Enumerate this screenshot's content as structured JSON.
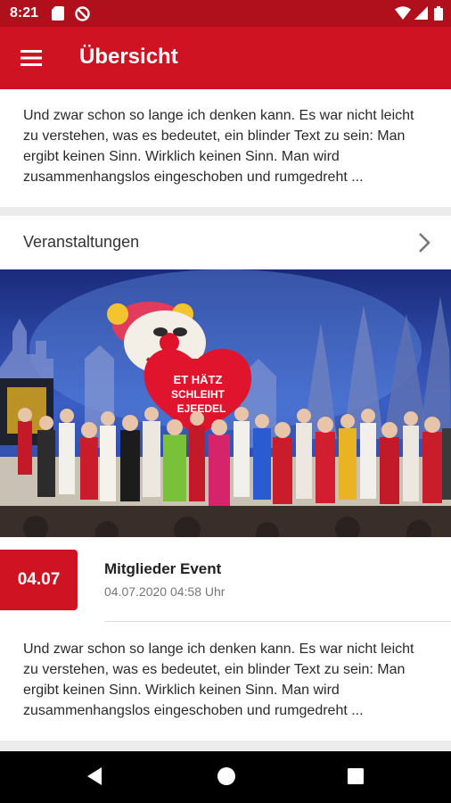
{
  "status_bar": {
    "time": "8:21",
    "icons": [
      "sd-card-icon",
      "do-not-disturb-icon",
      "wifi-icon",
      "signal-icon",
      "battery-icon"
    ]
  },
  "app_bar": {
    "title": "Übersicht",
    "menu_icon": "hamburger-menu-icon",
    "color": "#cf1322"
  },
  "intro": {
    "text": "Und zwar schon so lange ich denken kann. Es war nicht leicht zu verstehen, was es bedeutet, ein blinder Text zu sein: Man ergibt keinen Sinn. Wirklich keinen Sinn. Man wird zusammenhangslos eingeschoben und rumgedreht ..."
  },
  "section": {
    "label": "Veranstaltungen",
    "icon": "chevron-right-icon"
  },
  "event": {
    "badge": "04.07",
    "title": "Mitglieder Event",
    "datetime": "04.07.2020 04:58 Uhr",
    "photo_sign": [
      "ET HÄTZ",
      "SCHLEIHT",
      "EJEEDEL"
    ],
    "text": " Und zwar schon so lange ich denken kann. Es war nicht leicht zu verstehen, was es bedeutet, ein blinder Text zu sein: Man ergibt keinen Sinn. Wirklich keinen Sinn. Man wird zusammenhangslos eingeschoben und rumgedreht ..."
  },
  "nav_bar": {
    "icons": [
      "back-icon",
      "home-icon",
      "recents-icon"
    ]
  }
}
